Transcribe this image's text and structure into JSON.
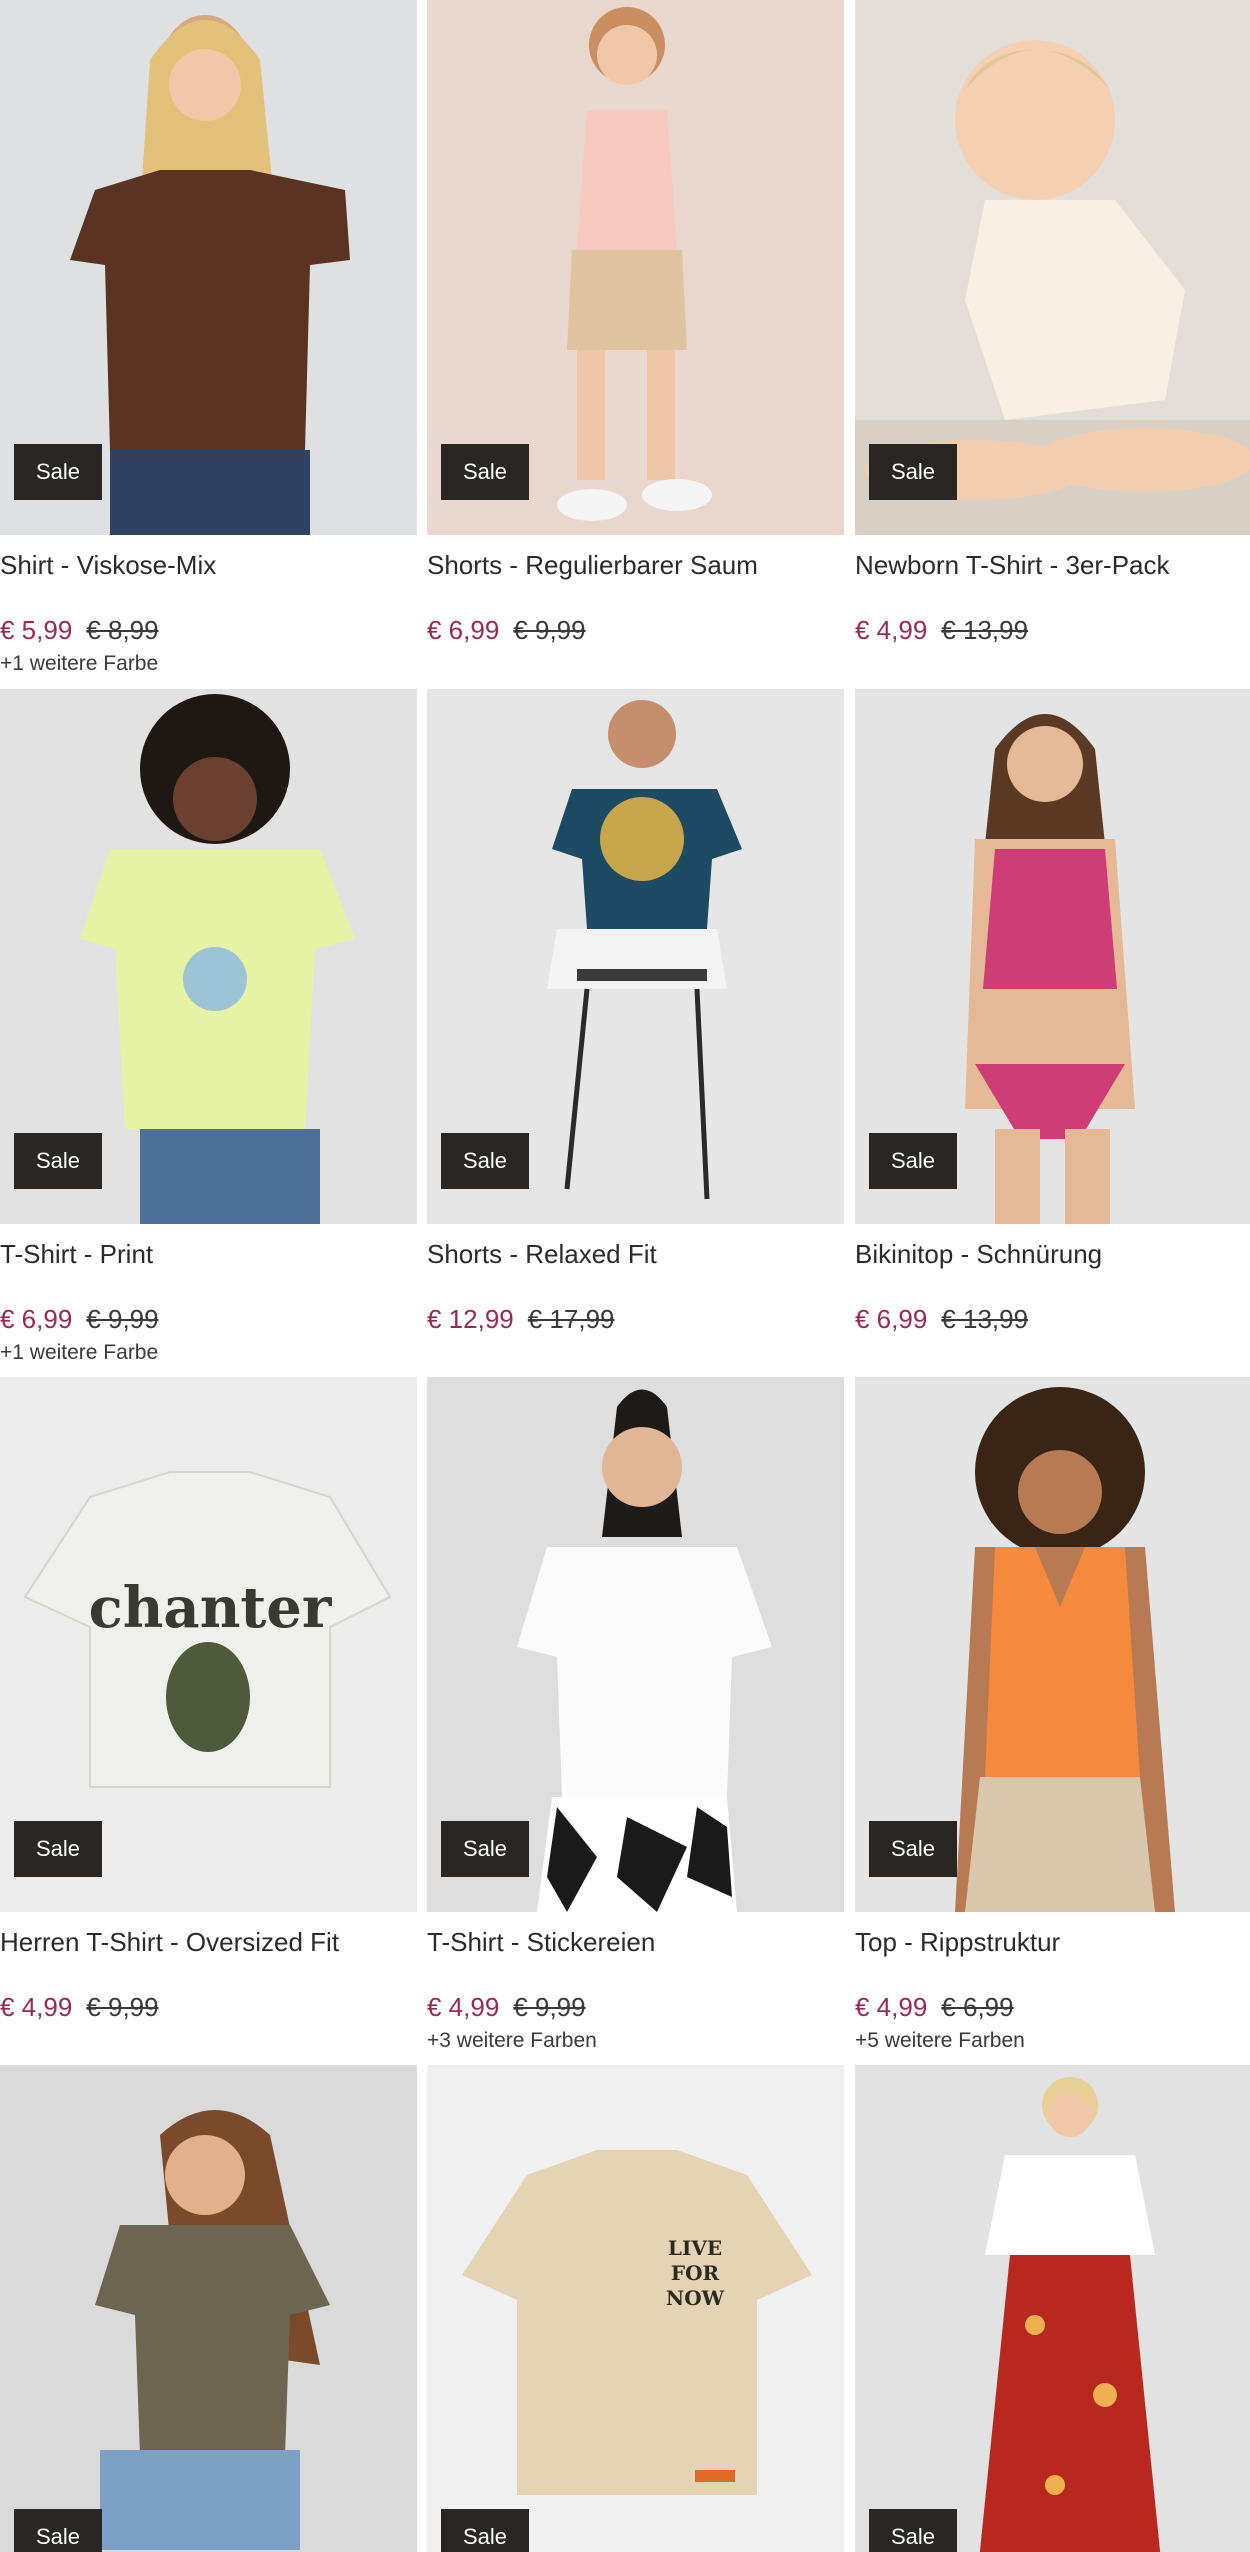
{
  "badge_label": "Sale",
  "products": [
    {
      "title": "Shirt - Viskose-Mix",
      "price": "€ 5,99",
      "old_price": "€ 8,99",
      "more_colors": "+1 weitere Farbe",
      "bg": "#dfe0e2",
      "garment": "#5a3322"
    },
    {
      "title": "Shorts - Regulierbarer Saum",
      "price": "€ 6,99",
      "old_price": "€ 9,99",
      "more_colors": "",
      "bg": "#e9d6cc",
      "garment": "#f6c8bf"
    },
    {
      "title": "Newborn T-Shirt - 3er-Pack",
      "price": "€ 4,99",
      "old_price": "€ 13,99",
      "more_colors": "",
      "bg": "#e4ded8",
      "garment": "#f7f0e2"
    },
    {
      "title": "T-Shirt - Print",
      "price": "€ 6,99",
      "old_price": "€ 9,99",
      "more_colors": "+1 weitere Farbe",
      "bg": "#e2e2e2",
      "garment": "#e6f3a4"
    },
    {
      "title": "Shorts - Relaxed Fit",
      "price": "€ 12,99",
      "old_price": "€ 17,99",
      "more_colors": "",
      "bg": "#e6e6e6",
      "garment": "#1d4b63"
    },
    {
      "title": "Bikinitop - Schnürung",
      "price": "€ 6,99",
      "old_price": "€ 13,99",
      "more_colors": "",
      "bg": "#e4e4e4",
      "garment": "#cf3d76"
    },
    {
      "title": "Herren T-Shirt - Oversized Fit",
      "price": "€ 4,99",
      "old_price": "€ 9,99",
      "more_colors": "",
      "bg": "#ececec",
      "garment": "#efefec"
    },
    {
      "title": "T-Shirt - Stickereien",
      "price": "€ 4,99",
      "old_price": "€ 9,99",
      "more_colors": "+3 weitere Farben",
      "bg": "#dedede",
      "garment": "#fbfbfb"
    },
    {
      "title": "Top - Rippstruktur",
      "price": "€ 4,99",
      "old_price": "€ 6,99",
      "more_colors": "+5 weitere Farben",
      "bg": "#e4e4e4",
      "garment": "#f58a3c"
    },
    {
      "title": "",
      "price": "",
      "old_price": "",
      "more_colors": "",
      "bg": "#dadada",
      "garment": "#6c6552"
    },
    {
      "title": "",
      "price": "",
      "old_price": "",
      "more_colors": "",
      "bg": "#f0f0f0",
      "garment": "#e4d3b5"
    },
    {
      "title": "",
      "price": "",
      "old_price": "",
      "more_colors": "",
      "bg": "#e2e2e2",
      "garment": "#b8281e"
    }
  ]
}
